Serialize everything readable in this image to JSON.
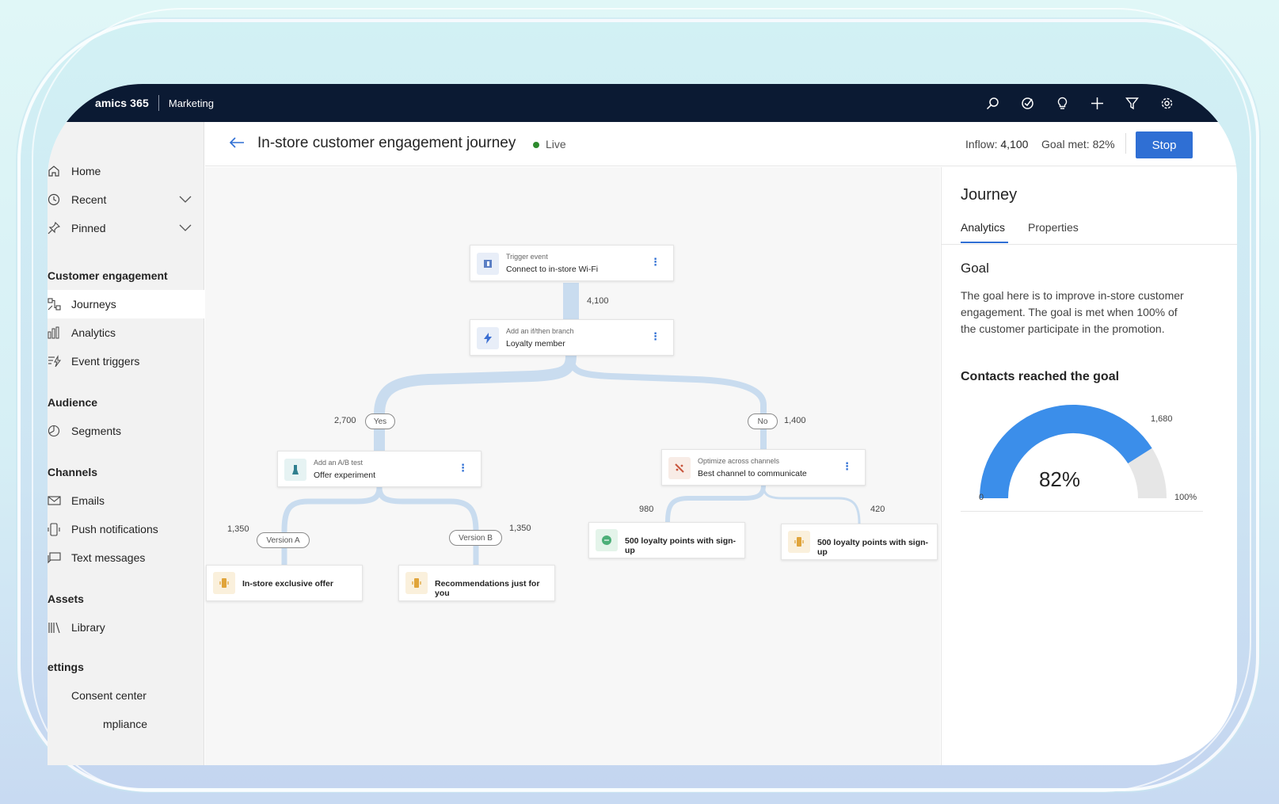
{
  "topbar": {
    "product": "amics 365",
    "module": "Marketing",
    "icons": [
      "search-icon",
      "task-icon",
      "lightbulb-icon",
      "plus-icon",
      "filter-icon",
      "gear-icon"
    ]
  },
  "sidebar": {
    "top_items": [
      {
        "label": "Home",
        "icon": "home-icon"
      },
      {
        "label": "Recent",
        "icon": "clock-icon"
      },
      {
        "label": "Pinned",
        "icon": "pin-icon"
      }
    ],
    "sections": {
      "customer_engagement": "Customer engagement",
      "audience": "Audience",
      "channels": "Channels",
      "assets": "Assets",
      "settings": "ettings"
    },
    "items": {
      "journeys": "Journeys",
      "analytics": "Analytics",
      "event_triggers": "Event triggers",
      "segments": "Segments",
      "emails": "Emails",
      "push_notifications": "Push notifications",
      "text_messages": "Text messages",
      "library": "Library",
      "consent_center": "Consent center",
      "compliance": "mpliance"
    }
  },
  "header": {
    "title": "In-store customer engagement journey",
    "status": "Live",
    "inflow_label": "Inflow:",
    "inflow_value": "4,100",
    "goal_met": "Goal met: 82%",
    "stop_label": "Stop"
  },
  "journey": {
    "trigger": {
      "sub": "Trigger event",
      "main": "Connect to in-store Wi-Fi"
    },
    "trigger_count": "4,100",
    "branch": {
      "sub": "Add an if/then branch",
      "main": "Loyalty member"
    },
    "yes_label": "Yes",
    "yes_count": "2,700",
    "no_label": "No",
    "no_count": "1,400",
    "ab_test": {
      "sub": "Add an A/B test",
      "main": "Offer experiment"
    },
    "optimize": {
      "sub": "Optimize across channels",
      "main": "Best channel to communicate"
    },
    "version_a_label": "Version A",
    "version_a_count": "1,350",
    "version_b_label": "Version B",
    "version_b_count": "1,350",
    "leaf_a": "In-store exclusive offer",
    "leaf_b": "Recommendations just for you",
    "channel_1_count": "980",
    "channel_2_count": "420",
    "leaf_c": "500 loyalty points with sign-up",
    "leaf_d": "500 loyalty points with sign-up",
    "colors": {
      "flow": "#c9dcef",
      "accent": "#2f6fd4"
    }
  },
  "panel": {
    "title": "Journey",
    "tabs": [
      "Analytics",
      "Properties"
    ],
    "goal_heading": "Goal",
    "goal_text": "The goal here is to improve in-store customer engagement. The goal is met when 100% of the customer participate in the promotion.",
    "contacts_heading": "Contacts reached the goal",
    "gauge": {
      "percent_label": "82%",
      "value_fraction": 0.82,
      "min_label": "0",
      "max_label": "100%",
      "target_label": "1,680",
      "fill_color": "#3b8eea",
      "track_color": "#e6e6e6"
    }
  }
}
